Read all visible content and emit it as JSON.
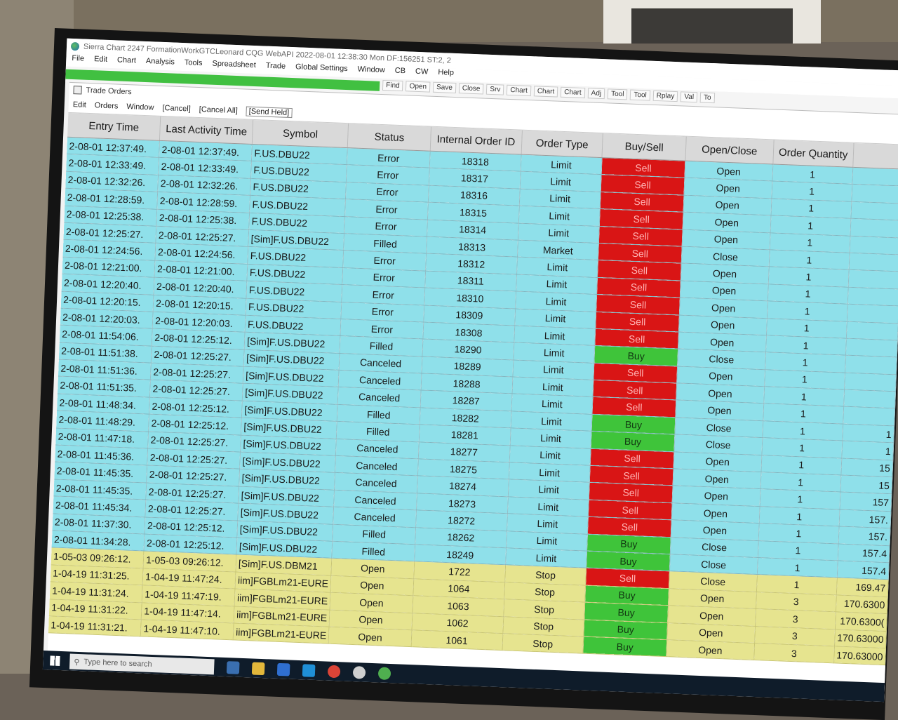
{
  "window": {
    "title": "Sierra Chart 2247 FormationWorkGTCLeonard CQG WebAPI 2022-08-01 12:38:30 Mon DF:156251 ST:2, 2"
  },
  "menu": [
    "File",
    "Edit",
    "Chart",
    "Analysis",
    "Tools",
    "Spreadsheet",
    "Trade",
    "Global Settings",
    "Window",
    "CB",
    "CW",
    "Help"
  ],
  "toolbar": [
    "Find",
    "Open",
    "Save",
    "Close",
    "Srv",
    "Chart",
    "Chart",
    "Chart",
    "Adj",
    "Tool",
    "Tool",
    "Rplay",
    "Val",
    "To"
  ],
  "trade_orders": {
    "title": "Trade Orders",
    "menu": [
      "Edit",
      "Orders",
      "Window",
      "[Cancel]",
      "[Cancel All]",
      "[Send Held]"
    ],
    "columns": [
      "Entry Time",
      "Last Activity Time",
      "Symbol",
      "Status",
      "Internal Order ID",
      "Order Type",
      "Buy/Sell",
      "Open/Close",
      "Order Quantity",
      ""
    ],
    "rows": [
      {
        "entry": "2-08-01 12:37:49.",
        "last": "2-08-01 12:37:49.",
        "symbol": "F.US.DBU22",
        "status": "Error",
        "oid": "18318",
        "type": "Limit",
        "side": "Sell",
        "oc": "Open",
        "qty": "1",
        "price": ""
      },
      {
        "entry": "2-08-01 12:33:49.",
        "last": "2-08-01 12:33:49.",
        "symbol": "F.US.DBU22",
        "status": "Error",
        "oid": "18317",
        "type": "Limit",
        "side": "Sell",
        "oc": "Open",
        "qty": "1",
        "price": ""
      },
      {
        "entry": "2-08-01 12:32:26.",
        "last": "2-08-01 12:32:26.",
        "symbol": "F.US.DBU22",
        "status": "Error",
        "oid": "18316",
        "type": "Limit",
        "side": "Sell",
        "oc": "Open",
        "qty": "1",
        "price": ""
      },
      {
        "entry": "2-08-01 12:28:59.",
        "last": "2-08-01 12:28:59.",
        "symbol": "F.US.DBU22",
        "status": "Error",
        "oid": "18315",
        "type": "Limit",
        "side": "Sell",
        "oc": "Open",
        "qty": "1",
        "price": ""
      },
      {
        "entry": "2-08-01 12:25:38.",
        "last": "2-08-01 12:25:38.",
        "symbol": "F.US.DBU22",
        "status": "Error",
        "oid": "18314",
        "type": "Limit",
        "side": "Sell",
        "oc": "Open",
        "qty": "1",
        "price": ""
      },
      {
        "entry": "2-08-01 12:25:27.",
        "last": "2-08-01 12:25:27.",
        "symbol": "[Sim]F.US.DBU22",
        "status": "Filled",
        "oid": "18313",
        "type": "Market",
        "side": "Sell",
        "oc": "Close",
        "qty": "1",
        "price": ""
      },
      {
        "entry": "2-08-01 12:24:56.",
        "last": "2-08-01 12:24:56.",
        "symbol": "F.US.DBU22",
        "status": "Error",
        "oid": "18312",
        "type": "Limit",
        "side": "Sell",
        "oc": "Open",
        "qty": "1",
        "price": ""
      },
      {
        "entry": "2-08-01 12:21:00.",
        "last": "2-08-01 12:21:00.",
        "symbol": "F.US.DBU22",
        "status": "Error",
        "oid": "18311",
        "type": "Limit",
        "side": "Sell",
        "oc": "Open",
        "qty": "1",
        "price": ""
      },
      {
        "entry": "2-08-01 12:20:40.",
        "last": "2-08-01 12:20:40.",
        "symbol": "F.US.DBU22",
        "status": "Error",
        "oid": "18310",
        "type": "Limit",
        "side": "Sell",
        "oc": "Open",
        "qty": "1",
        "price": ""
      },
      {
        "entry": "2-08-01 12:20:15.",
        "last": "2-08-01 12:20:15.",
        "symbol": "F.US.DBU22",
        "status": "Error",
        "oid": "18309",
        "type": "Limit",
        "side": "Sell",
        "oc": "Open",
        "qty": "1",
        "price": ""
      },
      {
        "entry": "2-08-01 12:20:03.",
        "last": "2-08-01 12:20:03.",
        "symbol": "F.US.DBU22",
        "status": "Error",
        "oid": "18308",
        "type": "Limit",
        "side": "Sell",
        "oc": "Open",
        "qty": "1",
        "price": ""
      },
      {
        "entry": "2-08-01 11:54:06.",
        "last": "2-08-01 12:25:12.",
        "symbol": "[Sim]F.US.DBU22",
        "status": "Filled",
        "oid": "18290",
        "type": "Limit",
        "side": "Buy",
        "oc": "Close",
        "qty": "1",
        "price": ""
      },
      {
        "entry": "2-08-01 11:51:38.",
        "last": "2-08-01 12:25:27.",
        "symbol": "[Sim]F.US.DBU22",
        "status": "Canceled",
        "oid": "18289",
        "type": "Limit",
        "side": "Sell",
        "oc": "Open",
        "qty": "1",
        "price": ""
      },
      {
        "entry": "2-08-01 11:51:36.",
        "last": "2-08-01 12:25:27.",
        "symbol": "[Sim]F.US.DBU22",
        "status": "Canceled",
        "oid": "18288",
        "type": "Limit",
        "side": "Sell",
        "oc": "Open",
        "qty": "1",
        "price": ""
      },
      {
        "entry": "2-08-01 11:51:35.",
        "last": "2-08-01 12:25:27.",
        "symbol": "[Sim]F.US.DBU22",
        "status": "Canceled",
        "oid": "18287",
        "type": "Limit",
        "side": "Sell",
        "oc": "Open",
        "qty": "1",
        "price": ""
      },
      {
        "entry": "2-08-01 11:48:34.",
        "last": "2-08-01 12:25:12.",
        "symbol": "[Sim]F.US.DBU22",
        "status": "Filled",
        "oid": "18282",
        "type": "Limit",
        "side": "Buy",
        "oc": "Close",
        "qty": "1",
        "price": "1"
      },
      {
        "entry": "2-08-01 11:48:29.",
        "last": "2-08-01 12:25:12.",
        "symbol": "[Sim]F.US.DBU22",
        "status": "Filled",
        "oid": "18281",
        "type": "Limit",
        "side": "Buy",
        "oc": "Close",
        "qty": "1",
        "price": "1"
      },
      {
        "entry": "2-08-01 11:47:18.",
        "last": "2-08-01 12:25:27.",
        "symbol": "[Sim]F.US.DBU22",
        "status": "Canceled",
        "oid": "18277",
        "type": "Limit",
        "side": "Sell",
        "oc": "Open",
        "qty": "1",
        "price": "15"
      },
      {
        "entry": "2-08-01 11:45:36.",
        "last": "2-08-01 12:25:27.",
        "symbol": "[Sim]F.US.DBU22",
        "status": "Canceled",
        "oid": "18275",
        "type": "Limit",
        "side": "Sell",
        "oc": "Open",
        "qty": "1",
        "price": "15"
      },
      {
        "entry": "2-08-01 11:45:35.",
        "last": "2-08-01 12:25:27.",
        "symbol": "[Sim]F.US.DBU22",
        "status": "Canceled",
        "oid": "18274",
        "type": "Limit",
        "side": "Sell",
        "oc": "Open",
        "qty": "1",
        "price": "157"
      },
      {
        "entry": "2-08-01 11:45:35.",
        "last": "2-08-01 12:25:27.",
        "symbol": "[Sim]F.US.DBU22",
        "status": "Canceled",
        "oid": "18273",
        "type": "Limit",
        "side": "Sell",
        "oc": "Open",
        "qty": "1",
        "price": "157."
      },
      {
        "entry": "2-08-01 11:45:34.",
        "last": "2-08-01 12:25:27.",
        "symbol": "[Sim]F.US.DBU22",
        "status": "Canceled",
        "oid": "18272",
        "type": "Limit",
        "side": "Sell",
        "oc": "Open",
        "qty": "1",
        "price": "157."
      },
      {
        "entry": "2-08-01 11:37:30.",
        "last": "2-08-01 12:25:12.",
        "symbol": "[Sim]F.US.DBU22",
        "status": "Filled",
        "oid": "18262",
        "type": "Limit",
        "side": "Buy",
        "oc": "Close",
        "qty": "1",
        "price": "157.4"
      },
      {
        "entry": "2-08-01 11:34:28.",
        "last": "2-08-01 12:25:12.",
        "symbol": "[Sim]F.US.DBU22",
        "status": "Filled",
        "oid": "18249",
        "type": "Limit",
        "side": "Buy",
        "oc": "Close",
        "qty": "1",
        "price": "157.4"
      },
      {
        "entry": "1-05-03 09:26:12.",
        "last": "1-05-03 09:26:12.",
        "symbol": "[Sim]F.US.DBM21",
        "status": "Open",
        "oid": "1722",
        "type": "Stop",
        "side": "Sell",
        "oc": "Close",
        "qty": "1",
        "price": "169.47"
      },
      {
        "entry": "1-04-19 11:31:25.",
        "last": "1-04-19 11:47:24.",
        "symbol": "iim]FGBLm21-EURE",
        "status": "Open",
        "oid": "1064",
        "type": "Stop",
        "side": "Buy",
        "oc": "Open",
        "qty": "3",
        "price": "170.6300"
      },
      {
        "entry": "1-04-19 11:31:24.",
        "last": "1-04-19 11:47:19.",
        "symbol": "iim]FGBLm21-EURE",
        "status": "Open",
        "oid": "1063",
        "type": "Stop",
        "side": "Buy",
        "oc": "Open",
        "qty": "3",
        "price": "170.6300("
      },
      {
        "entry": "1-04-19 11:31:22.",
        "last": "1-04-19 11:47:14.",
        "symbol": "iim]FGBLm21-EURE",
        "status": "Open",
        "oid": "1062",
        "type": "Stop",
        "side": "Buy",
        "oc": "Open",
        "qty": "3",
        "price": "170.63000"
      },
      {
        "entry": "1-04-19 11:31:21.",
        "last": "1-04-19 11:47:10.",
        "symbol": "iim]FGBLm21-EURE",
        "status": "Open",
        "oid": "1061",
        "type": "Stop",
        "side": "Buy",
        "oc": "Open",
        "qty": "3",
        "price": "170.63000"
      }
    ]
  },
  "taskbar": {
    "search_placeholder": "Type here to search"
  },
  "colors": {
    "row_sim": "#8fe0ea",
    "row_fgbl": "#e6e48f",
    "sell": "#d91515",
    "buy": "#3fc43a",
    "header": "#d9d9d9"
  }
}
